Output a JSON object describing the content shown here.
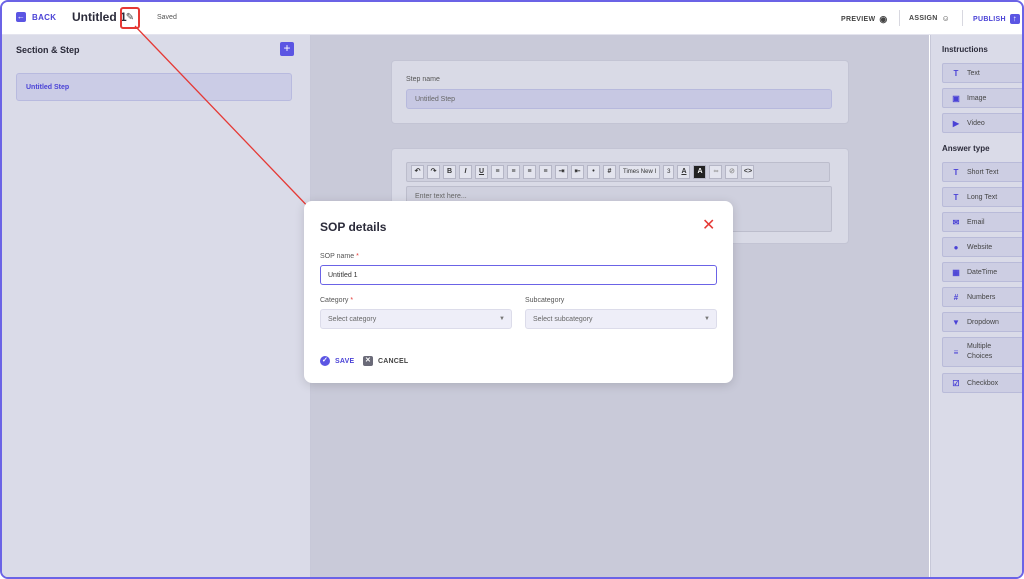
{
  "header": {
    "back_label": "BACK",
    "title": "Untitled 1",
    "status": "Saved",
    "preview_label": "PREVIEW",
    "assign_label": "ASSIGN",
    "publish_label": "PUBLISH"
  },
  "left_panel": {
    "heading": "Section & Step",
    "steps": [
      {
        "label": "Untitled Step"
      }
    ]
  },
  "center": {
    "step_name_label": "Step name",
    "step_name_value": "Untitled Step",
    "toolbar": {
      "font_name": "Times New I",
      "font_size": "3"
    },
    "editor_placeholder": "Enter text here..."
  },
  "right_panel": {
    "instructions_heading": "Instructions",
    "instructions": [
      {
        "label": "Text",
        "icon": "text-type-icon"
      },
      {
        "label": "Image",
        "icon": "image-icon"
      },
      {
        "label": "Video",
        "icon": "video-icon"
      }
    ],
    "answer_heading": "Answer type",
    "answers": [
      {
        "label": "Short Text",
        "icon": "text-type-icon"
      },
      {
        "label": "Long Text",
        "icon": "text-type-icon"
      },
      {
        "label": "Email",
        "icon": "mail-icon"
      },
      {
        "label": "Website",
        "icon": "globe-icon"
      },
      {
        "label": "DateTime",
        "icon": "calendar-icon"
      },
      {
        "label": "Numbers",
        "icon": "hash-icon"
      },
      {
        "label": "Dropdown",
        "icon": "dropdown-icon"
      },
      {
        "label": "Multiple Choices",
        "icon": "list-icon"
      },
      {
        "label": "Checkbox",
        "icon": "checkbox-icon"
      }
    ]
  },
  "modal": {
    "title": "SOP details",
    "sop_name_label": "SOP name",
    "sop_name_value": "Untitled 1",
    "category_label": "Category",
    "category_placeholder": "Select category",
    "subcategory_label": "Subcategory",
    "subcategory_placeholder": "Select subcategory",
    "save_label": "SAVE",
    "cancel_label": "CANCEL",
    "required_mark": "*"
  },
  "colors": {
    "accent": "#5b55e3",
    "annotation_red": "#e53935"
  }
}
